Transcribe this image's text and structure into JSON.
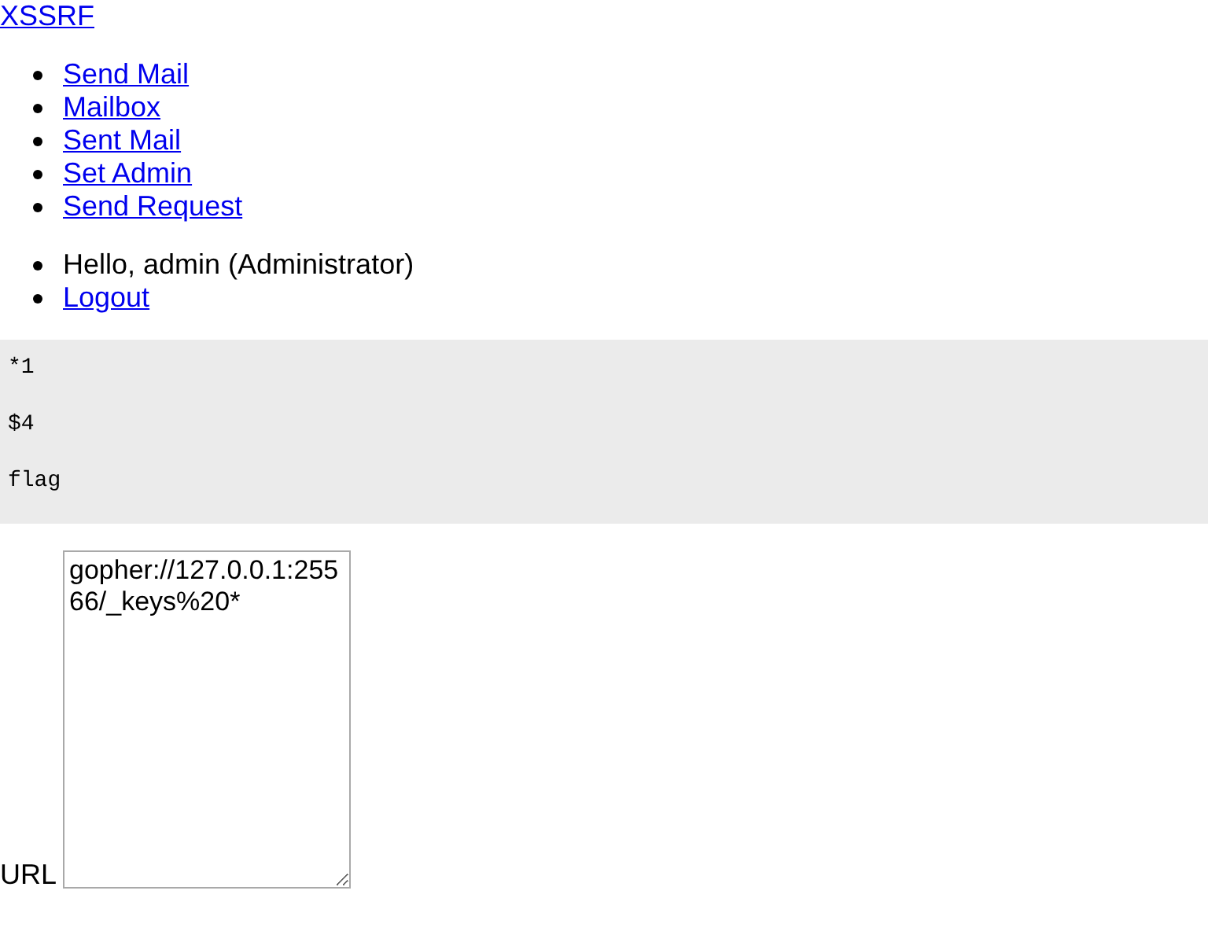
{
  "site": {
    "title": "XSSRF"
  },
  "nav": [
    {
      "label": "Send Mail"
    },
    {
      "label": "Mailbox"
    },
    {
      "label": "Sent Mail"
    },
    {
      "label": "Set Admin"
    },
    {
      "label": "Send Request"
    }
  ],
  "user_menu": [
    {
      "kind": "text",
      "label": "Hello, admin (Administrator)"
    },
    {
      "kind": "link",
      "label": "Logout"
    }
  ],
  "response": {
    "lines": [
      "*1",
      "$4",
      "flag"
    ]
  },
  "form": {
    "label": "URL",
    "url_value": "gopher://127.0.0.1:25566/_keys%20*"
  }
}
